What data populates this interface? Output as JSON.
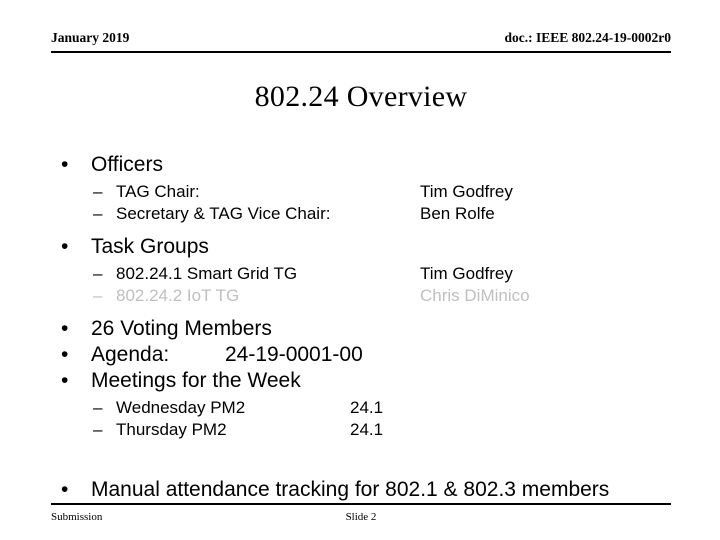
{
  "header": {
    "date": "January 2019",
    "doc_id": "doc.: IEEE 802.24-19-0002r0"
  },
  "title": "802.24 Overview",
  "content": {
    "officers": {
      "heading": "Officers",
      "rows": [
        {
          "role": "TAG Chair:",
          "person": "Tim Godfrey"
        },
        {
          "role": "Secretary & TAG Vice Chair:",
          "person": "Ben Rolfe"
        }
      ]
    },
    "task_groups": {
      "heading": "Task Groups",
      "rows": [
        {
          "group": "802.24.1  Smart Grid TG",
          "chair": "Tim Godfrey",
          "dimmed": false
        },
        {
          "group": "802.24.2 IoT TG",
          "chair": "Chris DiMinico",
          "dimmed": true
        }
      ]
    },
    "voting_members": "26 Voting Members",
    "agenda": {
      "label": "Agenda:",
      "value": "24-19-0001-00"
    },
    "meetings": {
      "heading": "Meetings for the Week",
      "rows": [
        {
          "when": "Wednesday PM2",
          "group": "24.1"
        },
        {
          "when": "Thursday PM2",
          "group": "24.1"
        }
      ]
    },
    "attendance_note": "Manual attendance tracking for 802.1 & 802.3 members"
  },
  "glyphs": {
    "bullet": "•",
    "dash": "–"
  },
  "footer": {
    "left": "Submission",
    "center": "Slide 2"
  },
  "colors": {
    "text": "#000000",
    "dimmed_text": "#bfbfbf",
    "background": "#ffffff"
  }
}
